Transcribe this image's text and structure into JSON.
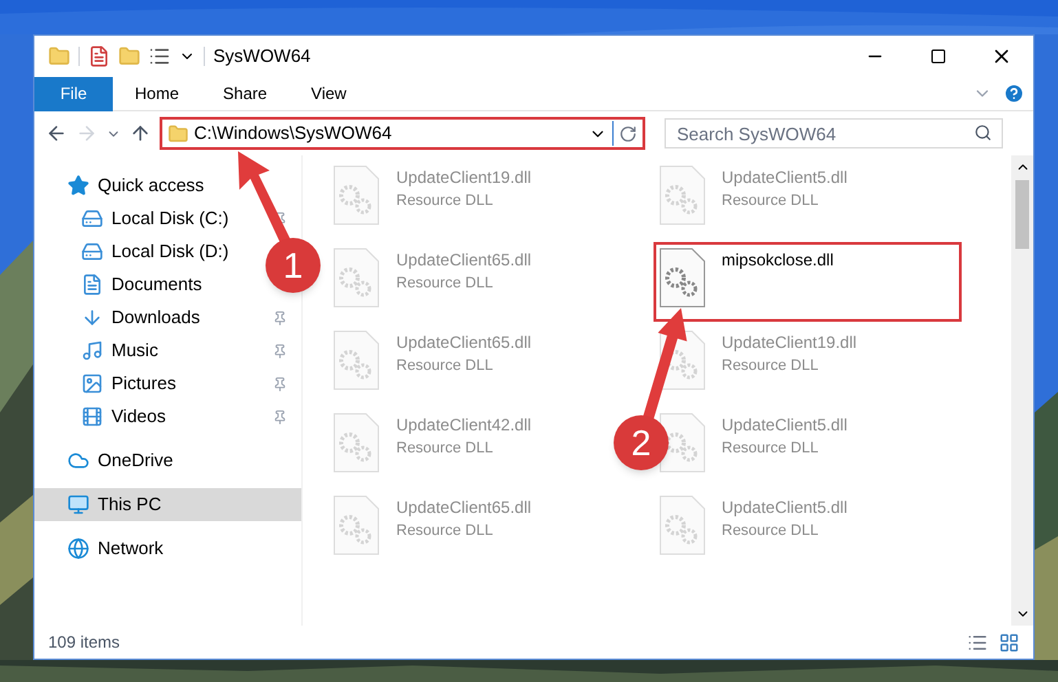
{
  "window": {
    "title": "SysWOW64"
  },
  "ribbon": {
    "tabs": [
      {
        "label": "File",
        "kind": "file",
        "selected": false
      },
      {
        "label": "Home",
        "kind": "tab",
        "selected": false
      },
      {
        "label": "Share",
        "kind": "tab",
        "selected": false
      },
      {
        "label": "View",
        "kind": "tab",
        "selected": false
      }
    ]
  },
  "address_bar": {
    "path": "C:\\Windows\\SysWOW64",
    "highlighted": true
  },
  "search": {
    "placeholder": "Search SysWOW64"
  },
  "sidebar": {
    "items": [
      {
        "label": "Quick access",
        "selected": false,
        "children": [
          {
            "label": "Local Disk (C:)",
            "pinned": true,
            "selected": false
          },
          {
            "label": "Local Disk (D:)",
            "pinned": false,
            "selected": false
          },
          {
            "label": "Documents",
            "pinned": false,
            "selected": false
          },
          {
            "label": "Downloads",
            "pinned": true,
            "selected": false
          },
          {
            "label": "Music",
            "pinned": true,
            "selected": false
          },
          {
            "label": "Pictures",
            "pinned": true,
            "selected": false
          },
          {
            "label": "Videos",
            "pinned": true,
            "selected": false
          }
        ]
      },
      {
        "label": "OneDrive",
        "selected": false
      },
      {
        "label": "This PC",
        "selected": true
      },
      {
        "label": "Network",
        "selected": false
      }
    ]
  },
  "files": [
    {
      "name": "UpdateClient19.dll",
      "type": "Resource DLL",
      "faded": true,
      "highlighted": false
    },
    {
      "name": "UpdateClient5.dll",
      "type": "Resource DLL",
      "faded": true,
      "highlighted": false
    },
    {
      "name": "UpdateClient65.dll",
      "type": "Resource DLL",
      "faded": true,
      "highlighted": false
    },
    {
      "name": "mipsokclose.dll",
      "faded": false,
      "highlighted": true
    },
    {
      "name": "UpdateClient65.dll",
      "type": "Resource DLL",
      "faded": true,
      "highlighted": false
    },
    {
      "name": "UpdateClient19.dll",
      "type": "Resource DLL",
      "faded": true,
      "highlighted": false
    },
    {
      "name": "UpdateClient42.dll",
      "type": "Resource DLL",
      "faded": true,
      "highlighted": false
    },
    {
      "name": "UpdateClient5.dll",
      "type": "Resource DLL",
      "faded": true,
      "highlighted": false
    },
    {
      "name": "UpdateClient65.dll",
      "type": "Resource DLL",
      "faded": true,
      "highlighted": false
    },
    {
      "name": "UpdateClient5.dll",
      "type": "Resource DLL",
      "faded": true,
      "highlighted": false
    }
  ],
  "status_bar": {
    "count": "109 items"
  },
  "callouts": [
    {
      "label": "1"
    },
    {
      "label": "2"
    }
  ]
}
